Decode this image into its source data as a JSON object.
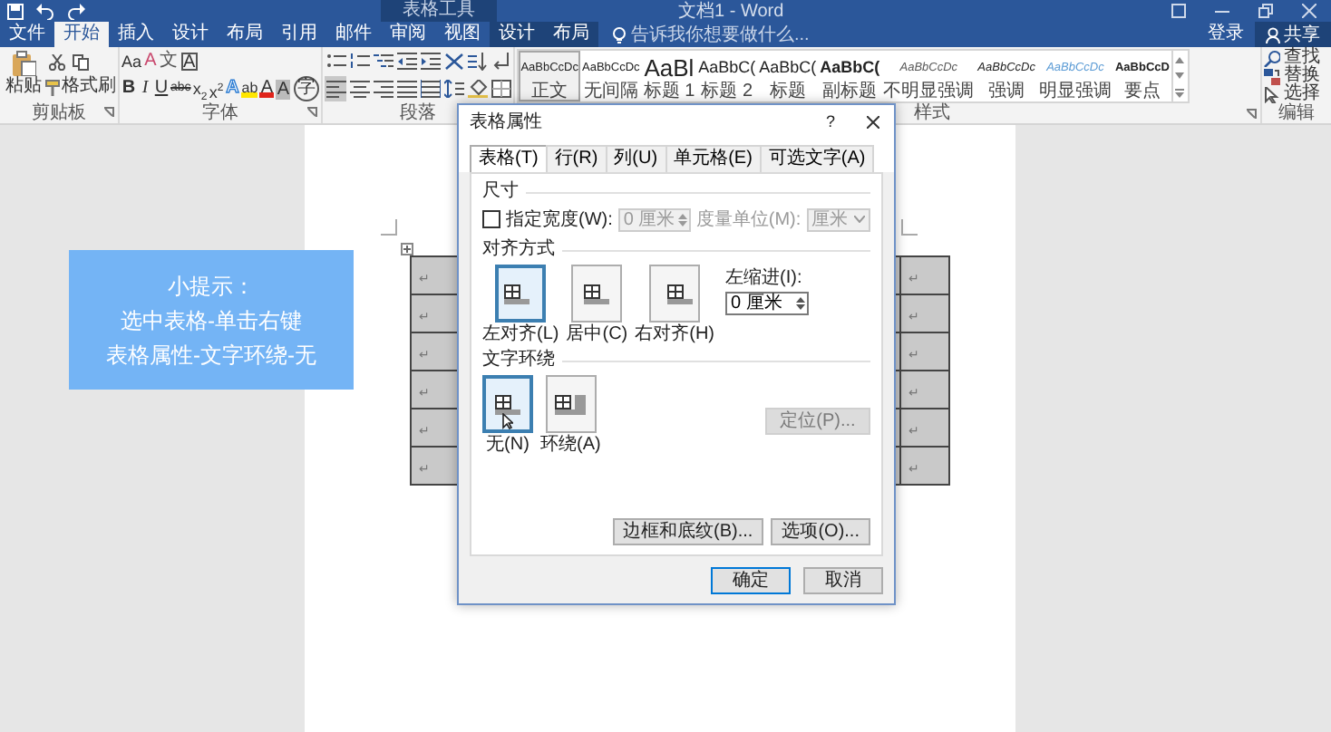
{
  "window": {
    "context_title": "表格工具",
    "title": "文档1 - Word"
  },
  "tabs": [
    {
      "label": "文件",
      "selected": false,
      "kind": "normal"
    },
    {
      "label": "开始",
      "selected": true,
      "kind": "normal"
    },
    {
      "label": "插入",
      "selected": false,
      "kind": "normal"
    },
    {
      "label": "设计",
      "selected": false,
      "kind": "normal"
    },
    {
      "label": "布局",
      "selected": false,
      "kind": "normal"
    },
    {
      "label": "引用",
      "selected": false,
      "kind": "normal"
    },
    {
      "label": "邮件",
      "selected": false,
      "kind": "normal"
    },
    {
      "label": "审阅",
      "selected": false,
      "kind": "normal"
    },
    {
      "label": "视图",
      "selected": false,
      "kind": "normal"
    },
    {
      "label": "设计",
      "selected": false,
      "kind": "context"
    },
    {
      "label": "布局",
      "selected": false,
      "kind": "context"
    }
  ],
  "tell_me": {
    "placeholder": "告诉我你想要做什么..."
  },
  "account": {
    "sign_in": "登录",
    "share": "共享"
  },
  "ribbon": {
    "clipboard": {
      "label": "剪贴板",
      "paste": "粘贴",
      "format_painter": "格式刷"
    },
    "font": {
      "label": "字体",
      "row1": [
        {
          "text": "Aa",
          "kind": "case"
        },
        {
          "text": "A",
          "kind": "clear"
        },
        {
          "text": "文",
          "kind": "phonetic"
        },
        {
          "text": "A",
          "kind": "boxed"
        }
      ],
      "row2": [
        {
          "text": "B",
          "kind": "bold"
        },
        {
          "text": "I",
          "kind": "italic"
        },
        {
          "text": "U",
          "kind": "underline"
        },
        {
          "text": "abc",
          "kind": "strike"
        },
        {
          "text": "x$_{2}$",
          "kind": "sub"
        },
        {
          "text": "x$^{2}$",
          "kind": "sup"
        },
        {
          "text": "A",
          "kind": "effect"
        },
        {
          "text": "ab",
          "kind": "highlight"
        },
        {
          "text": "A",
          "kind": "color"
        },
        {
          "text": "A",
          "kind": "shade"
        },
        {
          "text": "字",
          "kind": "circle"
        }
      ]
    },
    "paragraph": {
      "label": "段落",
      "row1": [
        {
          "kind": "bullets"
        },
        {
          "kind": "numbering"
        },
        {
          "kind": "multilevel"
        },
        {
          "kind": "outdent"
        },
        {
          "kind": "indent"
        },
        {
          "kind": "asian-layout"
        },
        {
          "kind": "sort"
        },
        {
          "kind": "marks"
        }
      ],
      "row2": [
        {
          "kind": "align-left",
          "selected": true
        },
        {
          "kind": "align-center",
          "selected": false
        },
        {
          "kind": "align-right",
          "selected": false
        },
        {
          "kind": "justify",
          "selected": false
        },
        {
          "kind": "distribute",
          "selected": false
        },
        {
          "kind": "line-spacing",
          "selected": false
        },
        {
          "kind": "shading",
          "selected": false
        },
        {
          "kind": "borders",
          "selected": false
        }
      ]
    },
    "styles": {
      "label": "样式",
      "items": [
        {
          "sample": "AaBbCcDc",
          "name": "正文",
          "kind": "body",
          "selected": true
        },
        {
          "sample": "AaBbCcDc",
          "name": "无间隔",
          "kind": "body",
          "selected": false
        },
        {
          "sample": "AaBl",
          "name": "标题 1",
          "kind": "heading1",
          "selected": false
        },
        {
          "sample": "AaBbC(",
          "name": "标题 2",
          "kind": "heading2",
          "selected": false
        },
        {
          "sample": "AaBbC(",
          "name": "标题",
          "kind": "heading2",
          "selected": false
        },
        {
          "sample": "AaBbC(",
          "name": "副标题",
          "kind": "subtitle",
          "selected": false
        },
        {
          "sample": "AaBbCcDc",
          "name": "不明显强调",
          "kind": "subtle",
          "selected": false
        },
        {
          "sample": "AaBbCcDc",
          "name": "强调",
          "kind": "emphasis",
          "selected": false
        },
        {
          "sample": "AaBbCcDc",
          "name": "明显强调",
          "kind": "intense",
          "selected": false
        },
        {
          "sample": "AaBbCcD",
          "name": "要点",
          "kind": "strong",
          "selected": false
        }
      ]
    },
    "editing": {
      "label": "编辑",
      "items": [
        {
          "text": "查找",
          "kind": "find"
        },
        {
          "text": "替换",
          "kind": "replace"
        },
        {
          "text": "选择",
          "kind": "select"
        }
      ]
    }
  },
  "tip": {
    "lines": [
      "小提示：",
      "选中表格-单击右键",
      "表格属性-文字环绕-无"
    ]
  },
  "table": {
    "rows": [
      {
        "cells": [
          "↵",
          "↵"
        ]
      },
      {
        "cells": [
          "↵",
          "↵"
        ]
      },
      {
        "cells": [
          "↵",
          "↵"
        ]
      },
      {
        "cells": [
          "↵",
          "↵"
        ]
      },
      {
        "cells": [
          "↵",
          "↵"
        ]
      },
      {
        "cells": [
          "↵",
          "↵"
        ]
      }
    ]
  },
  "dialog": {
    "title": "表格属性",
    "help": "?",
    "tabs": [
      {
        "label": "表格(T)",
        "selected": true
      },
      {
        "label": "行(R)",
        "selected": false
      },
      {
        "label": "列(U)",
        "selected": false
      },
      {
        "label": "单元格(E)",
        "selected": false
      },
      {
        "label": "可选文字(A)",
        "selected": false
      }
    ],
    "size": {
      "heading": "尺寸",
      "width_check": {
        "label": "指定宽度(W):",
        "checked": false
      },
      "width": {
        "value": "0 厘米",
        "disabled": true
      },
      "unit_label": {
        "text": "度量单位(M):",
        "disabled": true
      },
      "unit": {
        "value": "厘米",
        "disabled": true
      }
    },
    "alignment": {
      "heading": "对齐方式",
      "options": [
        {
          "label": "左对齐(L)",
          "kind": "left",
          "selected": true
        },
        {
          "label": "居中(C)",
          "kind": "center",
          "selected": false
        },
        {
          "label": "右对齐(H)",
          "kind": "right",
          "selected": false
        }
      ],
      "indent_label": "左缩进(I):",
      "indent": "0 厘米"
    },
    "wrapping": {
      "heading": "文字环绕",
      "options": [
        {
          "label": "无(N)",
          "kind": "none",
          "selected": true
        },
        {
          "label": "环绕(A)",
          "kind": "around",
          "selected": false
        }
      ],
      "position": {
        "label": "定位(P)...",
        "disabled": true
      }
    },
    "borders_button": "边框和底纹(B)...",
    "options_button": "选项(O)...",
    "ok": "确定",
    "cancel": "取消"
  }
}
